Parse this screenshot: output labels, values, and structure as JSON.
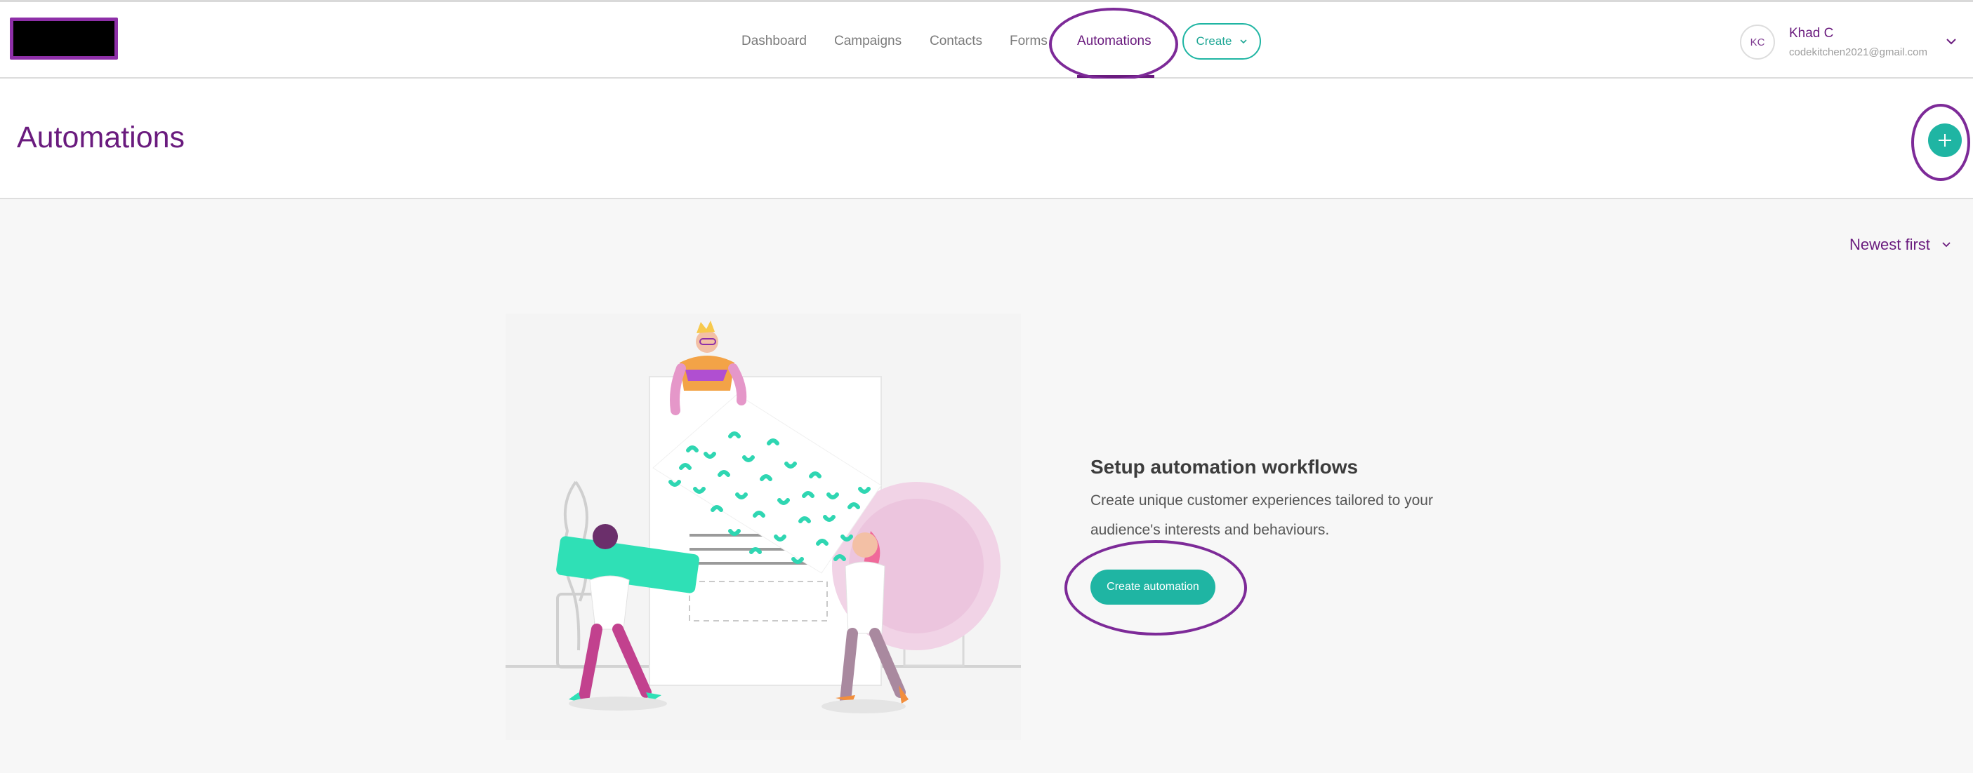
{
  "nav": {
    "links": [
      "Dashboard",
      "Campaigns",
      "Contacts",
      "Forms",
      "Automations"
    ],
    "active": "Automations",
    "create_label": "Create"
  },
  "user": {
    "initials": "KC",
    "name": "Khad C",
    "email": "codekitchen2021@gmail.com"
  },
  "header": {
    "title": "Automations"
  },
  "sort": {
    "label": "Newest first"
  },
  "empty_state": {
    "title": "Setup automation workflows",
    "desc_line1": "Create unique customer experiences tailored to your",
    "desc_line2": "audience's interests and behaviours.",
    "cta": "Create automation"
  },
  "colors": {
    "brand_purple": "#6a1b7e",
    "accent_teal": "#1fb5a3",
    "annotation_ring": "#7d2a98"
  }
}
